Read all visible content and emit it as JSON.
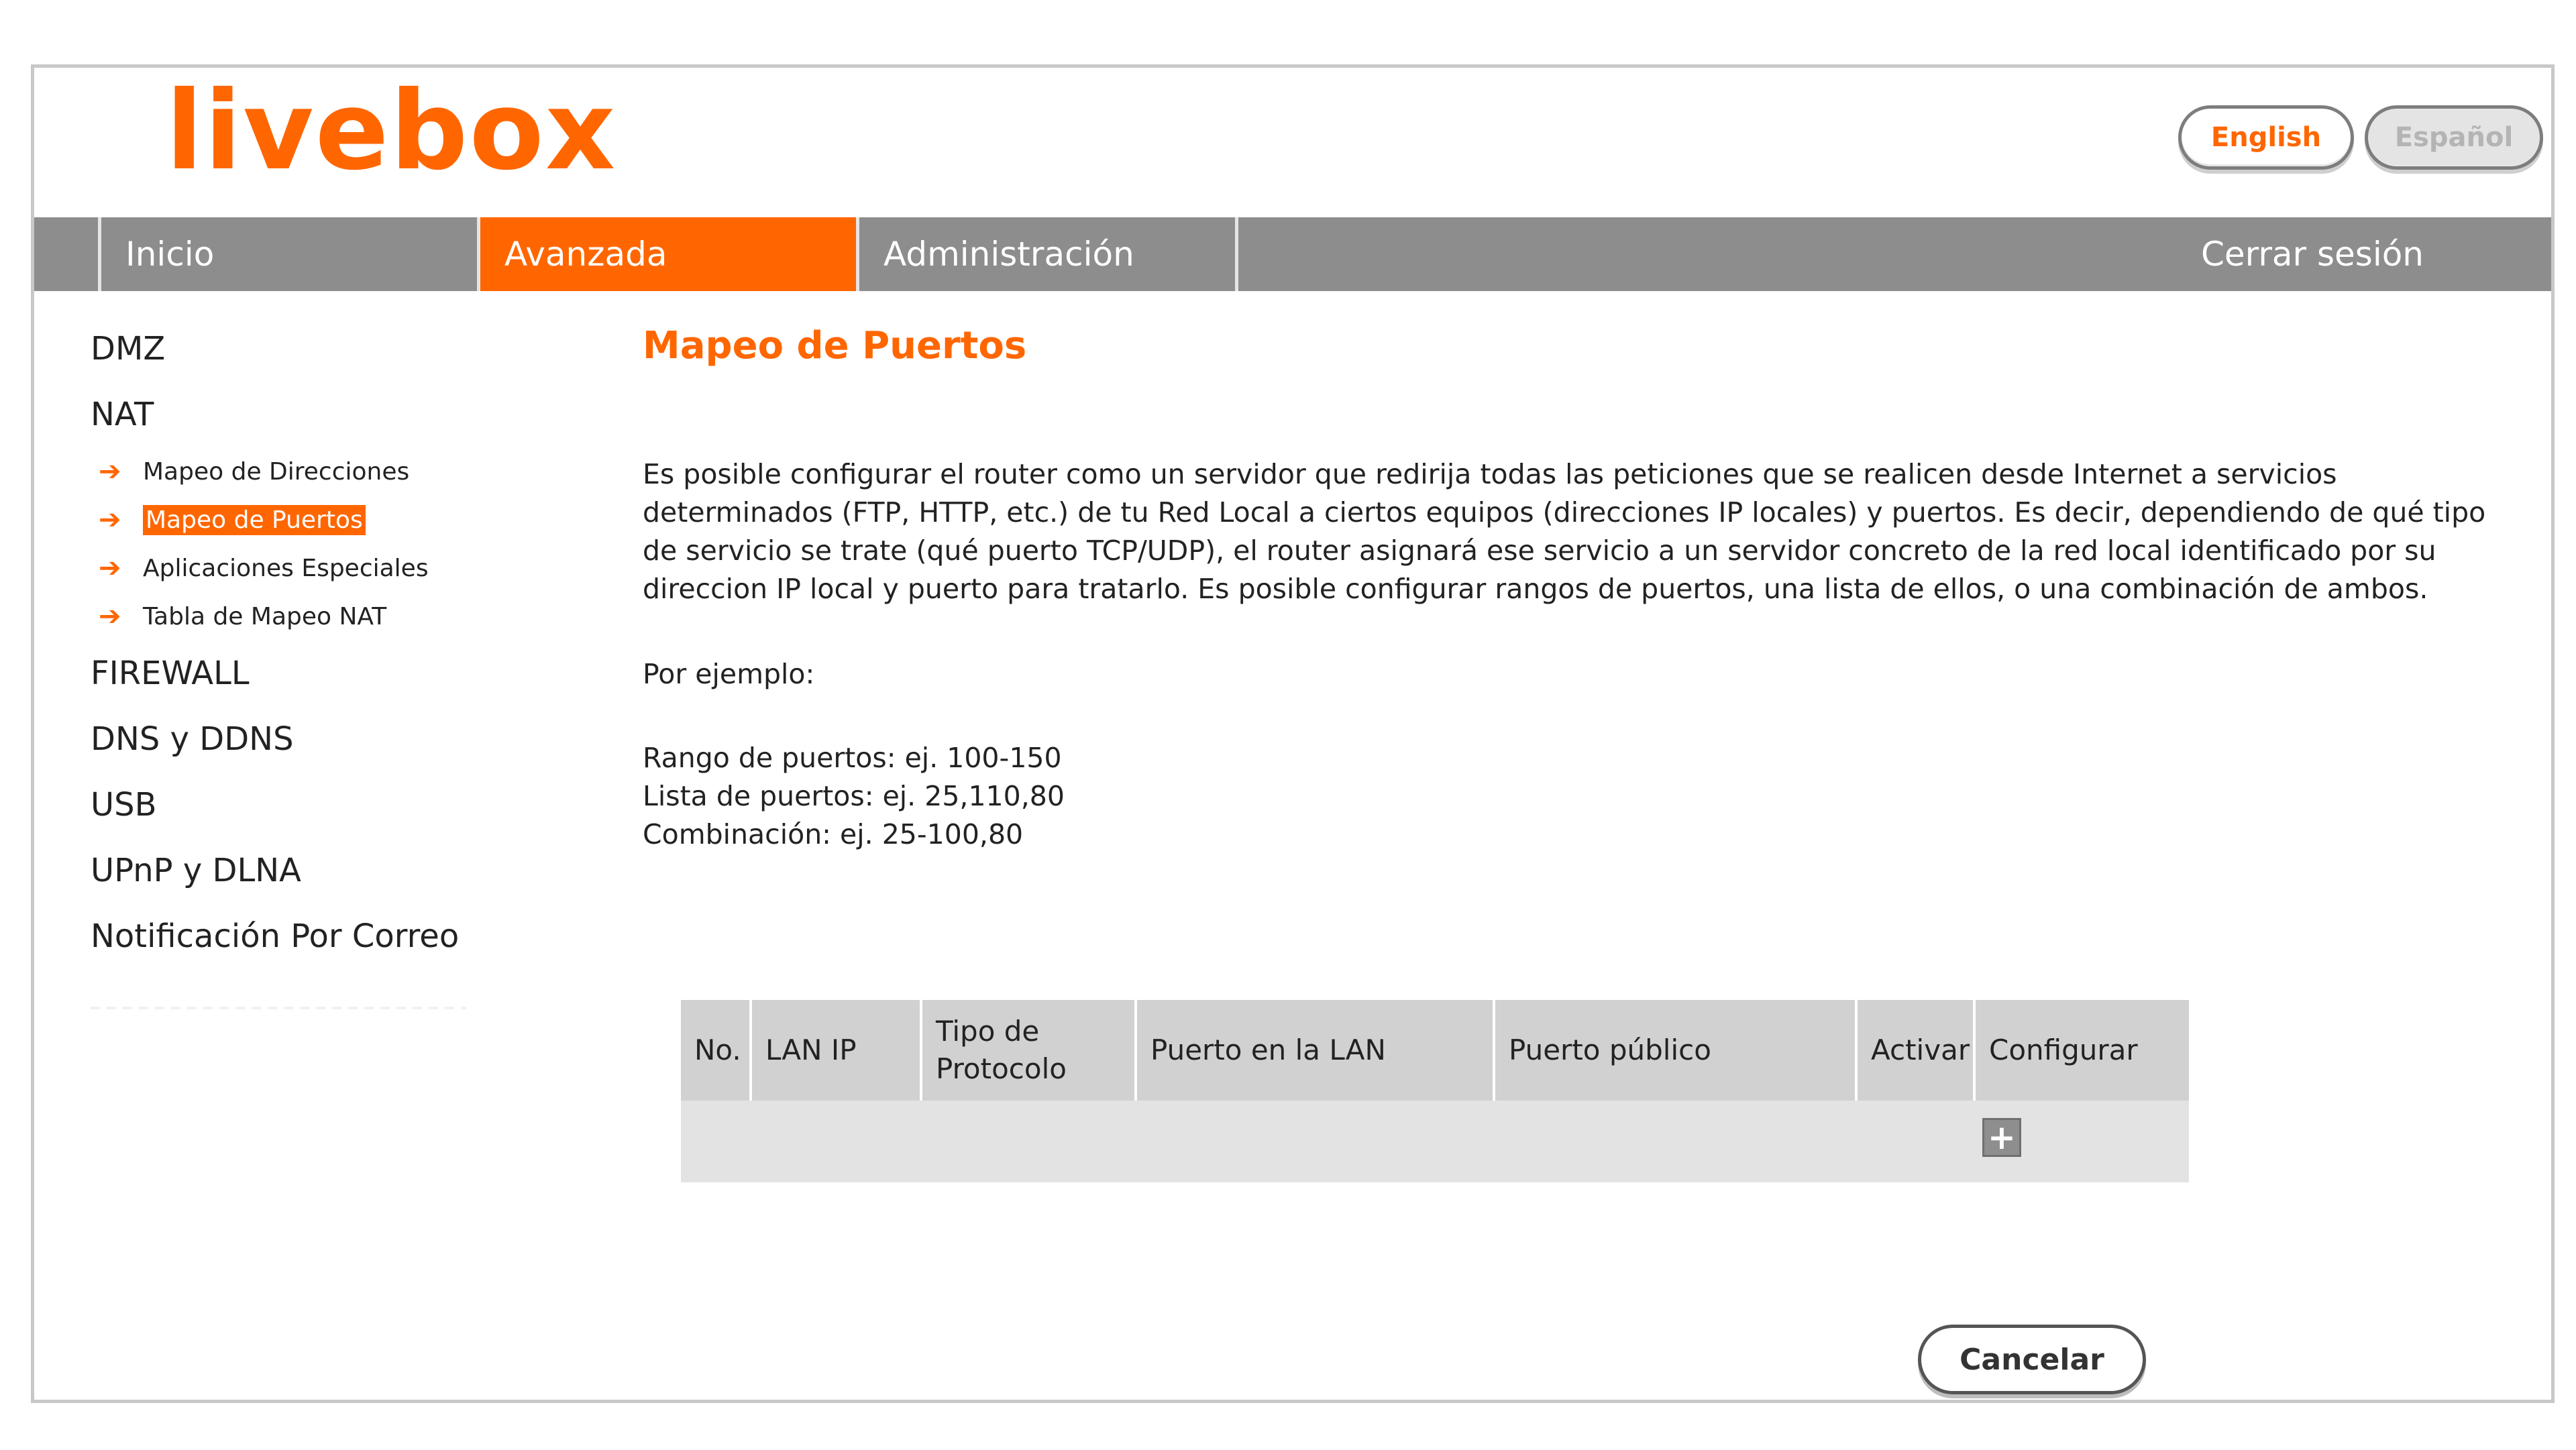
{
  "header": {
    "logo_text": "livebox",
    "languages": [
      {
        "label": "English",
        "active": true
      },
      {
        "label": "Español",
        "active": false
      }
    ]
  },
  "nav": {
    "items": [
      {
        "label": "Inicio",
        "active": false
      },
      {
        "label": "Avanzada",
        "active": true
      },
      {
        "label": "Administración",
        "active": false
      }
    ],
    "logout_label": "Cerrar sesión"
  },
  "sidebar": {
    "items": [
      {
        "label": "DMZ"
      },
      {
        "label": "NAT"
      },
      {
        "label": "FIREWALL"
      },
      {
        "label": "DNS y DDNS"
      },
      {
        "label": "USB"
      },
      {
        "label": "UPnP y DLNA"
      },
      {
        "label": "Notificación Por Correo"
      }
    ],
    "nat_sub": [
      {
        "label": "Mapeo de Direcciones",
        "active": false
      },
      {
        "label": "Mapeo de Puertos",
        "active": true
      },
      {
        "label": "Aplicaciones Especiales",
        "active": false
      },
      {
        "label": "Tabla de Mapeo NAT",
        "active": false
      }
    ],
    "arrow_glyph": "➔"
  },
  "main": {
    "title": "Mapeo de Puertos",
    "description": "Es posible configurar el router como un servidor que redirija todas las peticiones que se realicen desde Internet a servicios determinados (FTP, HTTP, etc.) de tu Red Local a ciertos equipos (direcciones IP locales) y puertos. Es decir, dependiendo de qué tipo de servicio se trate (qué puerto TCP/UDP), el router asignará ese servicio a un servidor concreto de la red local identificado por su direccion IP local y puerto para tratarlo. Es posible configurar rangos de puertos, una lista de ellos, o una combinación de ambos.",
    "example_label": "Por ejemplo:",
    "examples": [
      "Rango de puertos: ej. 100-150",
      "Lista de puertos: ej. 25,110,80",
      "Combinación: ej. 25-100,80"
    ]
  },
  "table": {
    "headers": [
      "No.",
      "LAN IP",
      "Tipo de Protocolo",
      "Puerto en la LAN",
      "Puerto público",
      "Activar",
      "Configurar"
    ],
    "add_icon": "+"
  },
  "actions": {
    "cancel_label": "Cancelar"
  },
  "colors": {
    "accent": "#ff6600",
    "nav_bg": "#8d8d8d",
    "table_header_bg": "#d1d1d1",
    "table_body_bg": "#e3e3e3"
  }
}
